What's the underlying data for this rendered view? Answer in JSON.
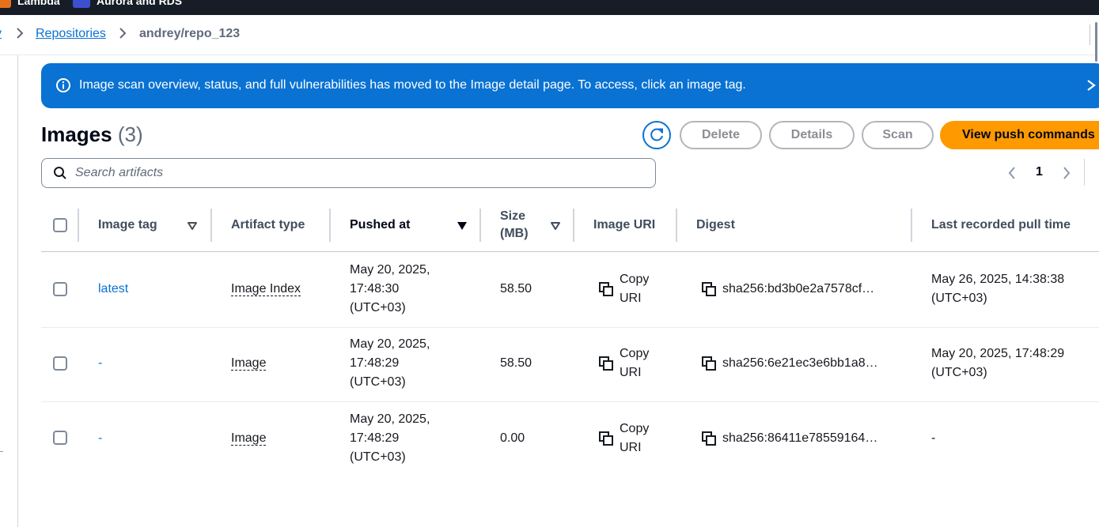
{
  "topbar": {
    "favorites": [
      {
        "label": "Lambda",
        "icon": "lambda-icon"
      },
      {
        "label": "Aurora and RDS",
        "icon": "aurora-rds-icon"
      }
    ]
  },
  "breadcrumb": {
    "prev_fragment": "y",
    "repositories": "Repositories",
    "current": "andrey/repo_123"
  },
  "flash": {
    "message": "Image scan overview, status, and full vulnerabilities has moved to the Image detail page. To access, click an image tag."
  },
  "header": {
    "title": "Images",
    "count": "(3)",
    "buttons": {
      "delete": "Delete",
      "details": "Details",
      "scan": "Scan",
      "push": "View push commands"
    }
  },
  "search": {
    "placeholder": "Search artifacts",
    "value": ""
  },
  "pagination": {
    "current_page": "1"
  },
  "table": {
    "columns": {
      "tag": "Image tag",
      "artifact_type": "Artifact type",
      "pushed_at": "Pushed at",
      "size_line1": "Size",
      "size_line2": "(MB)",
      "uri": "Image URI",
      "digest": "Digest",
      "last_pull": "Last recorded pull time"
    },
    "rows": [
      {
        "tag": "latest",
        "artifact_type": "Image Index",
        "pushed_date": "May 20, 2025,",
        "pushed_time": "17:48:30",
        "pushed_tz": "(UTC+03)",
        "size": "58.50",
        "copy_line1": "Copy",
        "copy_line2": "URI",
        "digest": "sha256:bd3b0e2a7578cf…",
        "pull_line1": "May 26, 2025, 14:38:38",
        "pull_line2": "(UTC+03)"
      },
      {
        "tag": "-",
        "artifact_type": "Image",
        "pushed_date": "May 20, 2025,",
        "pushed_time": "17:48:29",
        "pushed_tz": "(UTC+03)",
        "size": "58.50",
        "copy_line1": "Copy",
        "copy_line2": "URI",
        "digest": "sha256:6e21ec3e6bb1a8…",
        "pull_line1": "May 20, 2025, 17:48:29",
        "pull_line2": "(UTC+03)"
      },
      {
        "tag": "-",
        "artifact_type": "Image",
        "pushed_date": "May 20, 2025,",
        "pushed_time": "17:48:29",
        "pushed_tz": "(UTC+03)",
        "size": "0.00",
        "copy_line1": "Copy",
        "copy_line2": "URI",
        "digest": "sha256:86411e78559164…",
        "pull_line1": "-",
        "pull_line2": ""
      }
    ]
  },
  "colors": {
    "primary": "#0972d3",
    "accent_orange": "#ff9900",
    "topbar": "#161d26"
  }
}
